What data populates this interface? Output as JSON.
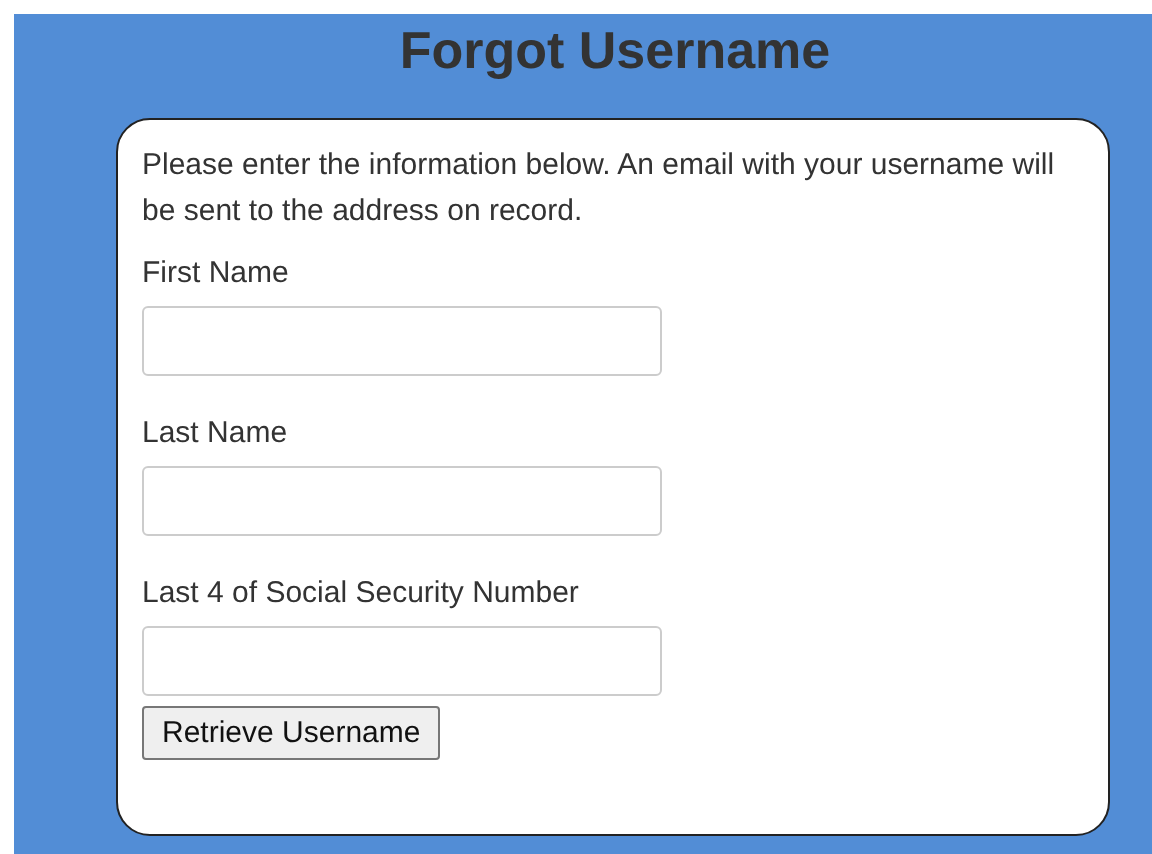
{
  "title": "Forgot Username",
  "intro": "Please enter the information below. An email with your username will be sent to the address on record.",
  "fields": [
    {
      "label": "First Name"
    },
    {
      "label": "Last Name"
    },
    {
      "label": "Last 4 of Social Security Number"
    }
  ],
  "button": "Retrieve Username"
}
